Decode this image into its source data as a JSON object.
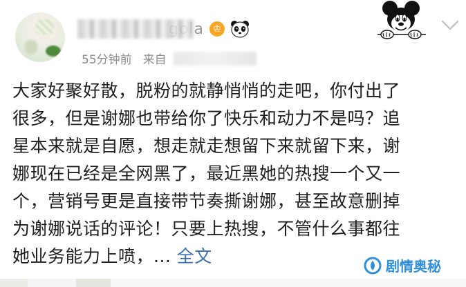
{
  "header": {
    "username_visible_tail": "gola",
    "badge_icon": "orange-v-verified-badge",
    "badge_glyph": "♔",
    "emoji_icon": "panda-icon",
    "time": "55分钟前",
    "source_prefix": "来自"
  },
  "post": {
    "lines": [
      "大家好聚好散，脱粉的就静悄悄的走吧，你付出了",
      "很多，但是谢娜也带给你了快乐和动力不是吗？追",
      "星本来就是自愿，想走就走想留下来就留下来，谢",
      "娜现在已经是全网黑了，最近黑她的热搜一个又一",
      "个，营销号更是直接带节奏撕谢娜，甚至故意删掉",
      "为谢娜说话的评论！只要上热搜，不管什么事都往",
      "她业务能力上喷，... "
    ],
    "full_text_link": "全文"
  },
  "watermark": {
    "text": "剧情奥秘",
    "icon": "watermark-logo-icon"
  },
  "colors": {
    "link": "#3a6fb0",
    "meta": "#8c8c8c",
    "badge": "#f6a623",
    "watermark": "#2f8fd8"
  }
}
